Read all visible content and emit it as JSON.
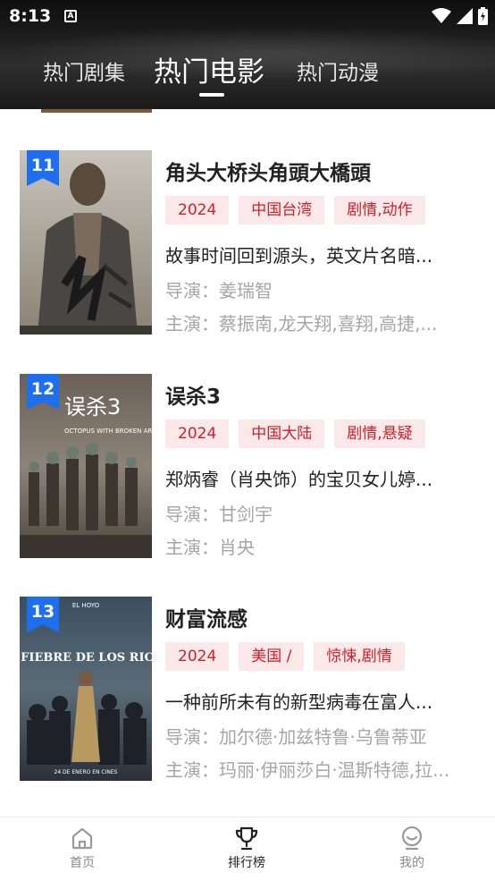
{
  "status_bar": {
    "time": "8:13",
    "notification_letter": "A"
  },
  "top_tabs": [
    {
      "label": "热门剧集"
    },
    {
      "label": "热门电影"
    },
    {
      "label": "热门动漫"
    }
  ],
  "movies": [
    {
      "rank": "11",
      "title": "角头大桥头角頭大橋頭",
      "tags": [
        "2024",
        "中国台湾",
        "剧情,动作"
      ],
      "description": "故事时间回到源头，英文片名暗...",
      "director": "导演：姜瑞智",
      "cast": "主演：蔡振南,龙天翔,喜翔,高捷,..."
    },
    {
      "rank": "12",
      "title": "误杀3",
      "tags": [
        "2024",
        "中国大陆",
        "剧情,悬疑"
      ],
      "description": "郑炳睿（肖央饰）的宝贝女儿婷...",
      "director": "导演：甘剑宇",
      "cast": "主演：肖央"
    },
    {
      "rank": "13",
      "title": "财富流感",
      "tags": [
        "2024",
        "美国 /",
        "惊悚,剧情"
      ],
      "description": "一种前所未有的新型病毒在富人...",
      "director": "导演：加尔德·加兹特鲁·乌鲁蒂亚",
      "cast": "主演：玛丽·伊丽莎白·温斯特德,拉..."
    }
  ],
  "poster_texts": {
    "poster_12_title": "误杀3",
    "poster_12_sub": "OCTOPUS WITH BROKEN ARMS",
    "poster_13_title": "LA FIEBRE DE LOS RICOS",
    "poster_13_top": "EL HOYO",
    "poster_13_date": "24 DE ENERO EN CINES"
  },
  "bottom_nav": [
    {
      "label": "首页",
      "icon": "home-icon"
    },
    {
      "label": "排行榜",
      "icon": "trophy-icon"
    },
    {
      "label": "我的",
      "icon": "profile-icon"
    }
  ],
  "colors": {
    "tag_bg": "#fbe9ea",
    "tag_text": "#d0202a",
    "badge_blue": "#1e6ff0"
  }
}
